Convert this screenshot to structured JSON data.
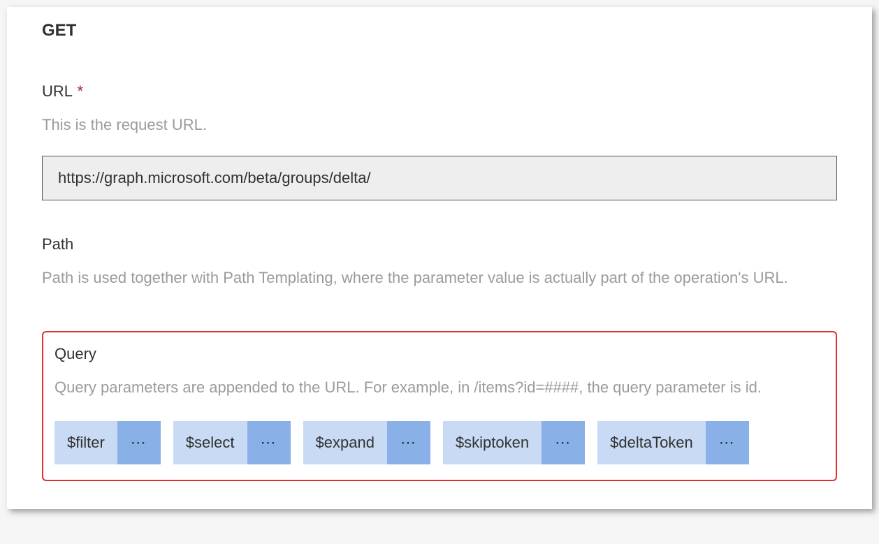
{
  "method": "GET",
  "url_section": {
    "label": "URL",
    "required_marker": "*",
    "description": "This is the request URL.",
    "value": "https://graph.microsoft.com/beta/groups/delta/"
  },
  "path_section": {
    "label": "Path",
    "description": "Path is used together with Path Templating, where the parameter value is actually part of the operation's URL."
  },
  "query_section": {
    "label": "Query",
    "description": "Query parameters are appended to the URL. For example, in /items?id=####, the query parameter is id.",
    "params": [
      {
        "name": "$filter",
        "more": "⋯"
      },
      {
        "name": "$select",
        "more": "⋯"
      },
      {
        "name": "$expand",
        "more": "⋯"
      },
      {
        "name": "$skiptoken",
        "more": "⋯"
      },
      {
        "name": "$deltaToken",
        "more": "⋯"
      }
    ]
  }
}
